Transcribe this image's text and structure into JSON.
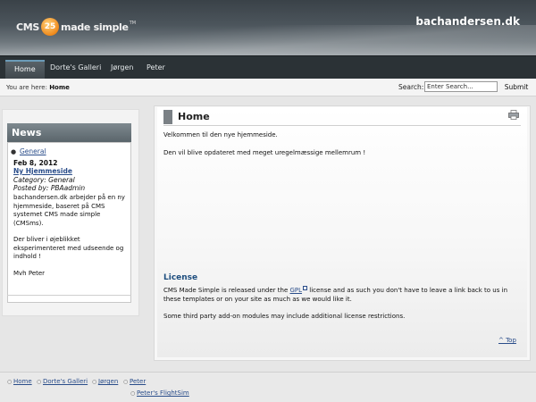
{
  "header": {
    "logo_left": "CMS",
    "logo_badge": "25",
    "logo_right": "made simple",
    "logo_tm": "TM",
    "site_name": "bachandersen.dk"
  },
  "nav": {
    "items": [
      {
        "label": "Home",
        "active": true
      },
      {
        "label": "Dorte's Galleri"
      },
      {
        "label": "Jørgen"
      },
      {
        "label": "Peter"
      }
    ]
  },
  "breadcrumb": {
    "prefix": "You are here:",
    "current": "Home"
  },
  "search": {
    "label": "Search:",
    "value": "Enter Search...",
    "button": "Submit"
  },
  "news": {
    "heading": "News",
    "category": "General",
    "date": "Feb 8, 2012",
    "title": "Ny Hjemmeside",
    "category_line": "Category: General",
    "posted_line": "Posted by: PBAadmin",
    "body_1": "bachandersen.dk arbejder på en ny hjemmeside, baseret på CMS systemet CMS made simple (CMSms).",
    "body_2": "Der bliver i øjeblikket eksperimenteret med udseende og indhold !",
    "body_3": "Mvh Peter"
  },
  "main": {
    "title": "Home",
    "para_1": "Velkommen til den nye hjemmeside.",
    "para_2": "Den vil blive opdateret med meget uregelmæssige mellemrum !",
    "license_title": "License",
    "license_pre": "CMS Made Simple is released under the ",
    "license_link": "GPL",
    "license_post": " license and as such you don't have to leave a link back to us in these templates or on your site as much as we would like it.",
    "third_party": "Some third party add-on modules may include additional license restrictions.",
    "top_link": "^ Top"
  },
  "footer": {
    "links": [
      "Home",
      "Dorte's Galleri",
      "Jørgen",
      "Peter"
    ],
    "sub_link": "Peter's FlightSim"
  },
  "colors": {
    "link": "#2a4d8a",
    "license_heading": "#1d4d7e",
    "nav_bg": "#2b3236"
  }
}
